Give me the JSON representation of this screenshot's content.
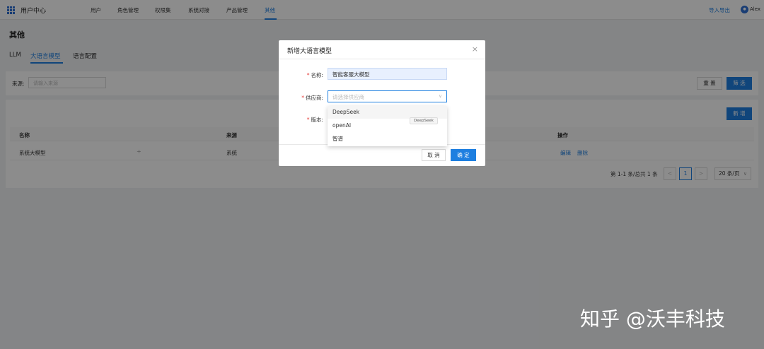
{
  "app": {
    "title": "用户中心",
    "user": "Alex",
    "avatar_initial": "Alex"
  },
  "nav": {
    "items": [
      {
        "label": "用户"
      },
      {
        "label": "角色管理"
      },
      {
        "label": "权限集"
      },
      {
        "label": "系统对接"
      },
      {
        "label": "产品管理"
      },
      {
        "label": "其他",
        "active": true
      }
    ],
    "import_export": "导入导出"
  },
  "page": {
    "title": "其他",
    "tabs": [
      {
        "label": "LLM"
      },
      {
        "label": "大语言模型",
        "active": true
      },
      {
        "label": "语言配置"
      }
    ]
  },
  "filter": {
    "source_label": "来源:",
    "source_placeholder": "请输入来源",
    "reset": "重 置",
    "submit": "筛 选"
  },
  "table": {
    "new_button": "新 增",
    "columns": [
      "名称",
      "来源",
      "操作"
    ],
    "rows": [
      {
        "name": "系统大模型",
        "source": "系统",
        "actions": [
          "编辑",
          "删除"
        ]
      }
    ]
  },
  "pagination": {
    "total": "第 1-1 条/总共 1 条",
    "prev": "<",
    "current": "1",
    "next": ">",
    "page_size": "20 条/页"
  },
  "modal": {
    "title": "新增大语言模型",
    "close": "×",
    "fields": {
      "name": {
        "label": "名称:",
        "value": "智能客服大模型"
      },
      "provider": {
        "label": "供应商:",
        "placeholder": "请选择供应商"
      },
      "version": {
        "label": "版本:"
      }
    },
    "cancel": "取 消",
    "ok": "确 定"
  },
  "dropdown": {
    "options": [
      "DeepSeek",
      "openAI",
      "智谱"
    ],
    "tooltip": "DeepSeek"
  },
  "watermark": "知乎 @沃丰科技",
  "colors": {
    "primary": "#1e7fe0",
    "required": "#e53935",
    "mask": "rgba(0,0,0,0.45)"
  }
}
